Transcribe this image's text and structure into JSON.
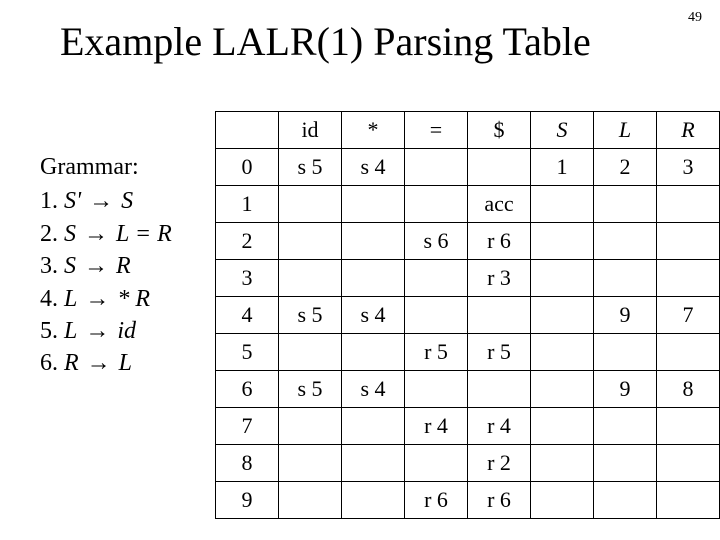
{
  "page_number": "49",
  "title": "Example LALR(1) Parsing Table",
  "grammar": {
    "heading": "Grammar:",
    "arrow": "→",
    "rules": [
      {
        "n": "1.",
        "lhs": "S'",
        "rhs": "S"
      },
      {
        "n": "2.",
        "lhs": "S",
        "rhs": "L = R"
      },
      {
        "n": "3.",
        "lhs": "S",
        "rhs": "R"
      },
      {
        "n": "4.",
        "lhs": "L",
        "rhs": "* R"
      },
      {
        "n": "5.",
        "lhs": "L",
        "rhs": "id"
      },
      {
        "n": "6.",
        "lhs": "R",
        "rhs": "L"
      }
    ]
  },
  "table": {
    "columns": [
      "id",
      "*",
      "=",
      "$",
      "S",
      "L",
      "R"
    ],
    "rows": [
      {
        "state": "0",
        "cells": [
          "s 5",
          "s 4",
          "",
          "",
          "1",
          "2",
          "3"
        ]
      },
      {
        "state": "1",
        "cells": [
          "",
          "",
          "",
          "acc",
          "",
          "",
          ""
        ]
      },
      {
        "state": "2",
        "cells": [
          "",
          "",
          "s 6",
          "r 6",
          "",
          "",
          ""
        ]
      },
      {
        "state": "3",
        "cells": [
          "",
          "",
          "",
          "r 3",
          "",
          "",
          ""
        ]
      },
      {
        "state": "4",
        "cells": [
          "s 5",
          "s 4",
          "",
          "",
          "",
          "9",
          "7"
        ]
      },
      {
        "state": "5",
        "cells": [
          "",
          "",
          "r 5",
          "r 5",
          "",
          "",
          ""
        ]
      },
      {
        "state": "6",
        "cells": [
          "s 5",
          "s 4",
          "",
          "",
          "",
          "9",
          "8"
        ]
      },
      {
        "state": "7",
        "cells": [
          "",
          "",
          "r 4",
          "r 4",
          "",
          "",
          ""
        ]
      },
      {
        "state": "8",
        "cells": [
          "",
          "",
          "",
          "r 2",
          "",
          "",
          ""
        ]
      },
      {
        "state": "9",
        "cells": [
          "",
          "",
          "r 6",
          "r 6",
          "",
          "",
          ""
        ]
      }
    ]
  }
}
